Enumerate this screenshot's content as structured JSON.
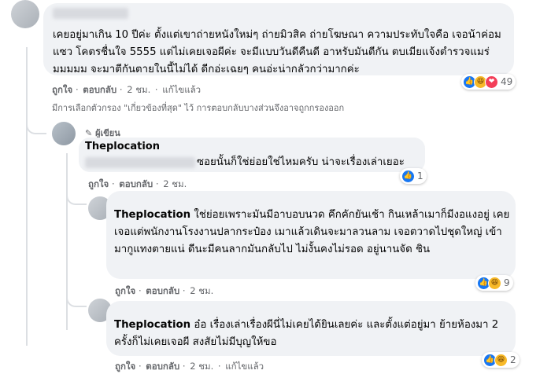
{
  "comment1": {
    "text": "เคยอยู่มาเกิน 10 ปีค่ะ ตั้งแต่เขาถ่ายหนังใหม่ๆ ถ่ายมิวสิค ถ่ายโฆษณา ความประทับใจคือ เจอน้าค่อมแซว โคตรชื่นใจ 5555 แต่ไม่เคยเจอผีค่ะ จะมีแบบวันดีคืนดี อาหรับมันตีกัน ตบเมียแจ้งตำรวจแมร่มมมมม จะมาตีกันตายในนี้ไม่ได้ ดีกอ่ะเฉยๆ คนอ่ะน่ากลัวกว่ามากค่ะ",
    "like": "ถูกใจ",
    "reply": "ตอบกลับ",
    "time": "2 ชม.",
    "edited": "แก้ไขแล้ว",
    "reactions": "49"
  },
  "filter_note": "มีการเลือกตัวกรอง \"เกี่ยวข้องที่สุด\" ไว้ การตอบกลับบางส่วนจึงอาจถูกกรองออก",
  "reply1": {
    "badge": "ผู้เขียน",
    "name": "Theplocation",
    "text": "ซอยนั้นก็ใช่ย่อยใช่ไหมครับ น่าจะเรื่องเล่าเยอะ",
    "like": "ถูกใจ",
    "reply": "ตอบกลับ",
    "time": "2 ชม.",
    "reactions": "1"
  },
  "reply2": {
    "name": "Theplocation",
    "text": " ใช่ย่อยเพราะมันมีอาบอบนวด คึกคักยันเช้า กินเหล้าเมาก็มีงอแงอยู่ เคยเจอแต่พนักงานโรงงานปลากระป๋อง เมาแล้วเดินจะมาลวนลาม เจอตวาดไปชุดใหญ่ เข้ามากูแทงตายแน่ ดีนะมีคนลากมันกลับไป ไม่งั้นคงไม่รอด อยู่นานจัด ชิน",
    "like": "ถูกใจ",
    "reply": "ตอบกลับ",
    "time": "2 ชม.",
    "reactions": "9"
  },
  "reply3": {
    "name": "Theplocation",
    "text": " อ๋อ เรื่องเล่าเรื่องผีนี่ไม่เคยได้ยินเลยค่ะ และตั้งแต่อยู่มา ย้ายห้องมา 2 ครั้งก็ไม่เคยเจอผี สงสัยไม่มีบุญให้ขอ",
    "like": "ถูกใจ",
    "reply": "ตอบกลับ",
    "time": "2 ชม.",
    "edited": "แก้ไขแล้ว",
    "reactions": "2"
  },
  "sep": "·"
}
